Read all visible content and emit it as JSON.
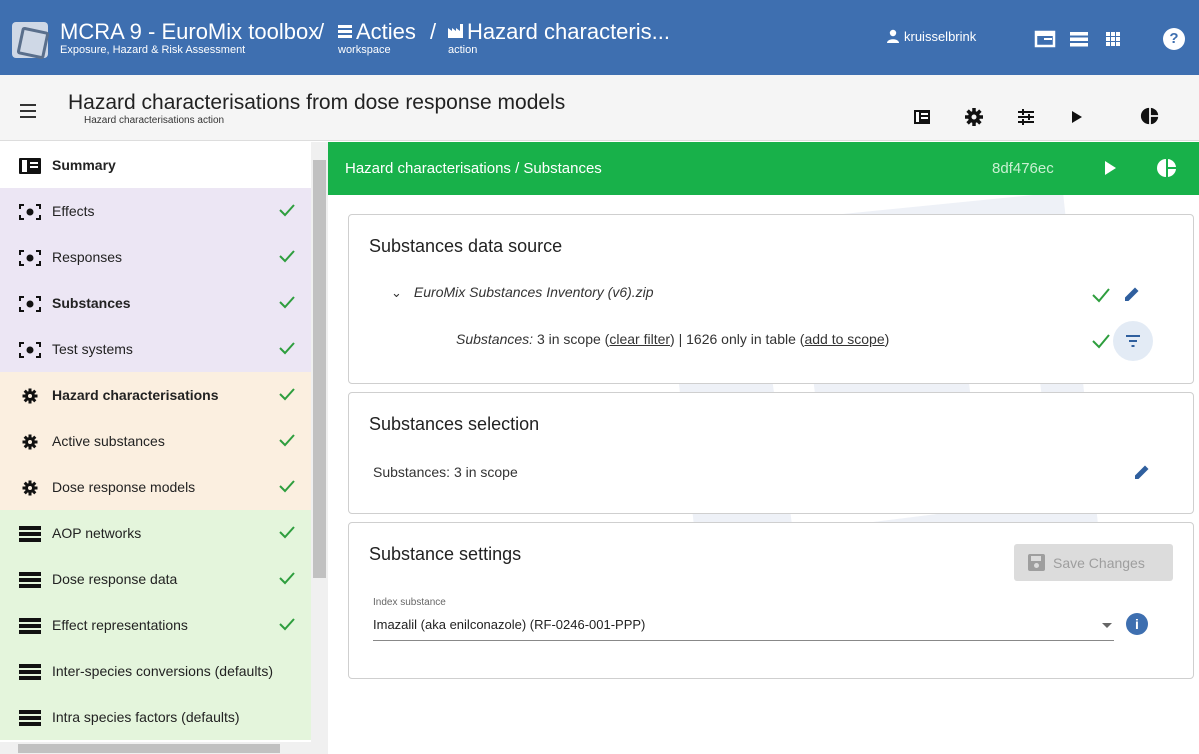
{
  "topbar": {
    "app_title": "MCRA 9 - EuroMix toolbox",
    "app_subtitle": "Exposure, Hazard & Risk Assessment",
    "separator": "/",
    "crumbs": [
      {
        "label": "Acties",
        "sub": "workspace",
        "icon": "table-icon"
      },
      {
        "label": "Hazard characteris...",
        "sub": "action",
        "icon": "factory-icon"
      }
    ],
    "username": "kruisselbrink",
    "help_label": "?"
  },
  "subbar": {
    "title": "Hazard characterisations from dose response models",
    "subtitle": "Hazard characterisations action"
  },
  "sidebar": {
    "items": [
      {
        "label": "Summary",
        "icon": "summary-icon",
        "checked": false,
        "group": "white",
        "bold": true
      },
      {
        "label": "Effects",
        "icon": "focus-icon",
        "checked": true,
        "group": "purple",
        "bold": false
      },
      {
        "label": "Responses",
        "icon": "focus-icon",
        "checked": true,
        "group": "purple",
        "bold": false
      },
      {
        "label": "Substances",
        "icon": "focus-icon",
        "checked": true,
        "group": "purple",
        "bold": true
      },
      {
        "label": "Test systems",
        "icon": "focus-icon",
        "checked": true,
        "group": "purple",
        "bold": false
      },
      {
        "label": "Hazard characterisations",
        "icon": "gear-icon",
        "checked": true,
        "group": "orange",
        "bold": true
      },
      {
        "label": "Active substances",
        "icon": "gear-icon",
        "checked": true,
        "group": "orange",
        "bold": false
      },
      {
        "label": "Dose response models",
        "icon": "gear-icon",
        "checked": true,
        "group": "orange",
        "bold": false
      },
      {
        "label": "AOP networks",
        "icon": "table-icon",
        "checked": true,
        "group": "green",
        "bold": false
      },
      {
        "label": "Dose response data",
        "icon": "table-icon",
        "checked": true,
        "group": "green",
        "bold": false
      },
      {
        "label": "Effect representations",
        "icon": "table-icon",
        "checked": true,
        "group": "green",
        "bold": false
      },
      {
        "label": "Inter-species conversions (defaults)",
        "icon": "table-icon",
        "checked": false,
        "group": "green",
        "bold": false
      },
      {
        "label": "Intra species factors (defaults)",
        "icon": "table-icon",
        "checked": false,
        "group": "green",
        "bold": false
      }
    ]
  },
  "main": {
    "header_title": "Hazard characterisations / Substances",
    "hash": "8df476ec",
    "datasource": {
      "title": "Substances data source",
      "file": "EuroMix Substances Inventory (v6).zip",
      "label": "Substances:",
      "in_scope": "3 in scope",
      "clear_filter": "clear filter",
      "sep": "|",
      "only_in_table": "1626 only in table",
      "add_to_scope": "add to scope"
    },
    "selection": {
      "title": "Substances selection",
      "text": "Substances: 3 in scope"
    },
    "settings": {
      "title": "Substance settings",
      "save_label": "Save Changes",
      "field_label": "Index substance",
      "field_value": "Imazalil (aka enilconazole) (RF-0246-001-PPP)"
    }
  },
  "colors": {
    "topbar": "#3e6fb0",
    "green_header": "#18b14a",
    "check": "#2e9e3e",
    "purple_group": "#ece6f4",
    "orange_group": "#fbefe0",
    "green_group": "#e4f5dc"
  }
}
